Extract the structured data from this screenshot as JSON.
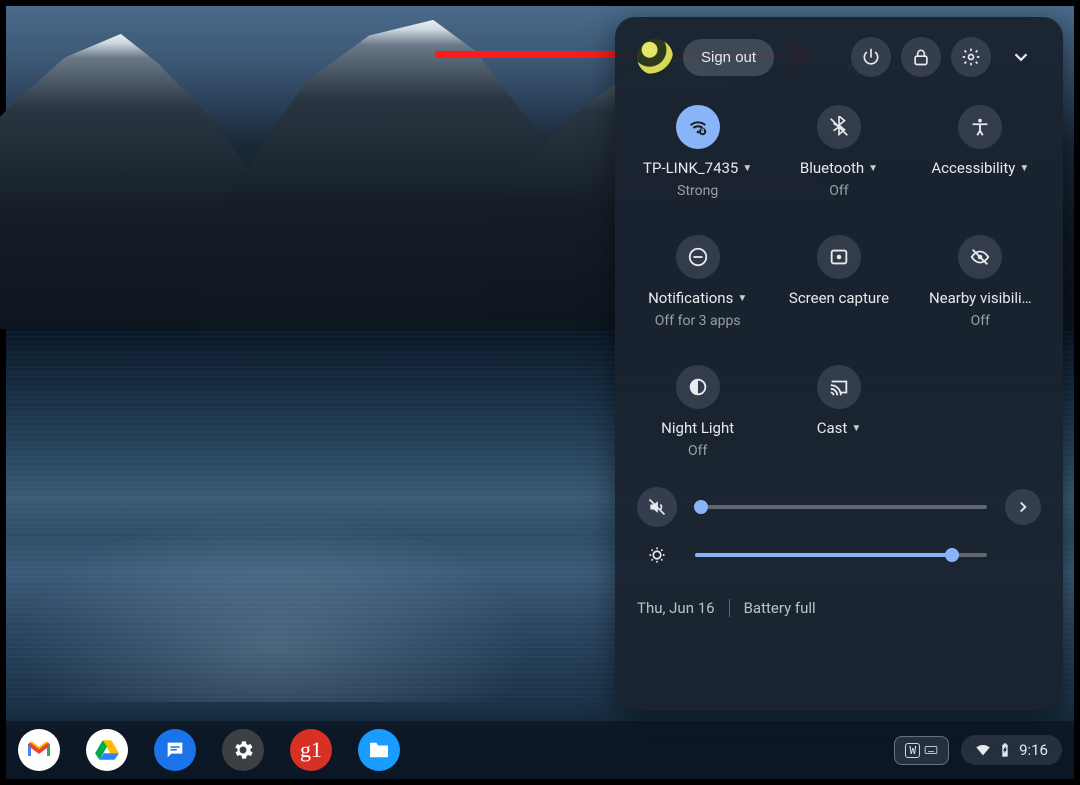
{
  "header": {
    "sign_out": "Sign out"
  },
  "tiles": {
    "wifi": {
      "label": "TP-LINK_7435",
      "sub": "Strong",
      "has_menu": true,
      "active": true
    },
    "bluetooth": {
      "label": "Bluetooth",
      "sub": "Off",
      "has_menu": true,
      "active": false
    },
    "accessibility": {
      "label": "Accessibility",
      "sub": "",
      "has_menu": true,
      "active": false
    },
    "notifications": {
      "label": "Notifications",
      "sub": "Off for 3 apps",
      "has_menu": true,
      "active": false
    },
    "screencap": {
      "label": "Screen capture",
      "sub": "",
      "has_menu": false,
      "active": false
    },
    "nearby": {
      "label": "Nearby visibili…",
      "sub": "Off",
      "has_menu": false,
      "active": false
    },
    "nightlight": {
      "label": "Night Light",
      "sub": "Off",
      "has_menu": false,
      "active": false
    },
    "cast": {
      "label": "Cast",
      "sub": "",
      "has_menu": true,
      "active": false
    }
  },
  "sliders": {
    "volume_pct": 2,
    "brightness_pct": 88
  },
  "footer": {
    "date": "Thu, Jun 16",
    "battery": "Battery full"
  },
  "shelf": {
    "ime_mode": "W",
    "clock": "9:16"
  },
  "apps": {
    "gmail": "Gmail",
    "drive": "Drive",
    "messages": "Messages",
    "settings": "Settings",
    "g1": "g1",
    "files": "Files"
  }
}
